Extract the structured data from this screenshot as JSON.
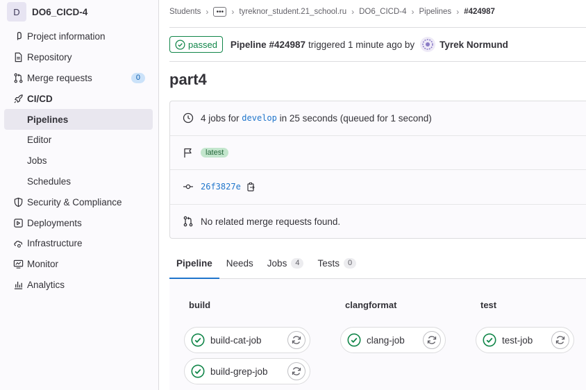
{
  "project": {
    "avatar_letter": "D",
    "name": "DO6_CICD-4"
  },
  "sidebar": {
    "items": [
      {
        "label": "Project information",
        "icon": "info-icon"
      },
      {
        "label": "Repository",
        "icon": "document-icon"
      },
      {
        "label": "Merge requests",
        "icon": "merge-request-icon",
        "count": "0"
      },
      {
        "label": "CI/CD",
        "icon": "rocket-icon"
      },
      {
        "label": "Pipelines"
      },
      {
        "label": "Editor"
      },
      {
        "label": "Jobs"
      },
      {
        "label": "Schedules"
      },
      {
        "label": "Security & Compliance",
        "icon": "shield-icon"
      },
      {
        "label": "Deployments",
        "icon": "deployments-icon"
      },
      {
        "label": "Infrastructure",
        "icon": "cloud-gear-icon"
      },
      {
        "label": "Monitor",
        "icon": "monitor-icon"
      },
      {
        "label": "Analytics",
        "icon": "chart-icon"
      }
    ]
  },
  "breadcrumb": {
    "items": [
      "Students",
      "tyreknor_student.21_school.ru",
      "DO6_CICD-4",
      "Pipelines",
      "#424987"
    ]
  },
  "header": {
    "status": "passed",
    "pipeline": "Pipeline #424987",
    "triggered": "triggered 1 minute ago by",
    "user": "Tyrek Normund"
  },
  "title": "part4",
  "info": {
    "jobs_prefix": "4 jobs for",
    "branch": "develop",
    "jobs_suffix": "in 25 seconds (queued for 1 second)",
    "tag": "latest",
    "commit": "26f3827e",
    "merge_requests": "No related merge requests found."
  },
  "tabs": [
    {
      "label": "Pipeline"
    },
    {
      "label": "Needs"
    },
    {
      "label": "Jobs",
      "count": "4"
    },
    {
      "label": "Tests",
      "count": "0"
    }
  ],
  "stages": [
    {
      "name": "build",
      "jobs": [
        "build-cat-job",
        "build-grep-job"
      ]
    },
    {
      "name": "clangformat",
      "jobs": [
        "clang-job"
      ]
    },
    {
      "name": "test",
      "jobs": [
        "test-job"
      ]
    }
  ],
  "colors": {
    "success": "#108548",
    "link": "#1f75cb",
    "active_bg": "#e9e7ef"
  }
}
